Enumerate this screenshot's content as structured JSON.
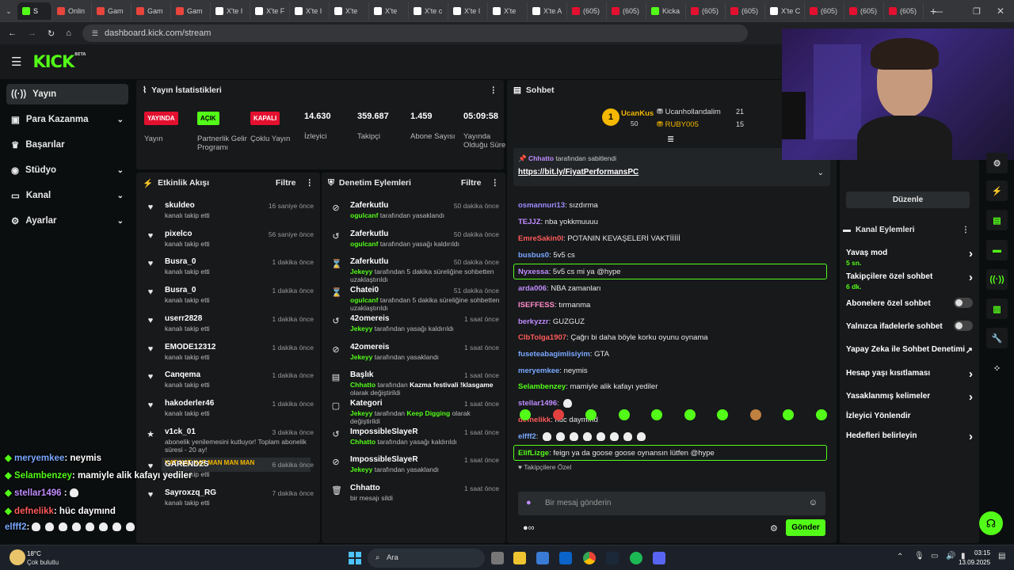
{
  "browser": {
    "tabs": [
      "S",
      "Onlin",
      "Gam",
      "Gam",
      "Gam",
      "X'te I",
      "X'te F",
      "X'te I",
      "X'te",
      "X'te",
      "X'te c",
      "X'te I",
      "X'te",
      "X'te A",
      "(605)",
      "(605)",
      "Kicka",
      "(605)",
      "(605)",
      "X'te C",
      "(605)",
      "(605)",
      "(605)"
    ],
    "url": "dashboard.kick.com/stream"
  },
  "app": {
    "logo": "KICK",
    "beta": "BETA"
  },
  "sidebar": {
    "items": [
      {
        "label": "Yayın",
        "icon": "broadcast-icon"
      },
      {
        "label": "Para Kazanma",
        "icon": "dollar-icon"
      },
      {
        "label": "Başarılar",
        "icon": "trophy-icon"
      },
      {
        "label": "Stüdyo",
        "icon": "studio-icon"
      },
      {
        "label": "Kanal",
        "icon": "channel-icon"
      },
      {
        "label": "Ayarlar",
        "icon": "gear-icon"
      }
    ]
  },
  "stats": {
    "title": "Yayın İstatistikleri",
    "items": [
      {
        "badge": "YAYINDA",
        "label": "Yayın",
        "color": "#e3102f"
      },
      {
        "badge": "AÇIK",
        "label": "Partnerlik Gelir Programı",
        "color": "#53fc18"
      },
      {
        "badge": "KAPALI",
        "label": "Çoklu Yayın",
        "color": "#e3102f"
      },
      {
        "value": "14.630",
        "label": "İzleyici"
      },
      {
        "value": "359.687",
        "label": "Takipçi"
      },
      {
        "value": "1.459",
        "label": "Abone Sayısı"
      },
      {
        "value": "05:09:58",
        "label": "Yayında Olduğu Süre"
      }
    ]
  },
  "activity": {
    "title": "Etkinlik Akışı",
    "filter": "Filtre",
    "rows": [
      {
        "name": "skuldeo",
        "sub": "kanalı takip etti",
        "time": "16 saniye önce"
      },
      {
        "name": "pixelco",
        "sub": "kanalı takip etti",
        "time": "56 saniye önce"
      },
      {
        "name": "Busra_0",
        "sub": "kanalı takip etti",
        "time": "1 dakika önce"
      },
      {
        "name": "Busra_0",
        "sub": "kanalı takip etti",
        "time": "1 dakika önce"
      },
      {
        "name": "userr2828",
        "sub": "kanalı takip etti",
        "time": "1 dakika önce"
      },
      {
        "name": "EMODE12312",
        "sub": "kanalı takip etti",
        "time": "1 dakika önce"
      },
      {
        "name": "Canqema",
        "sub": "kanalı takip etti",
        "time": "1 dakika önce"
      },
      {
        "name": "hakoderler46",
        "sub": "kanalı takip etti",
        "time": "1 dakika önce"
      },
      {
        "name": "v1ck_01",
        "sub": "abonelik yenilemesini kutluyor! Toplam abonelik süresi - 20 ay!",
        "time": "3 dakika önce"
      },
      {
        "name": "GAREND2S",
        "sub": "kanalı takip etti",
        "time": "6 dakika önce"
      },
      {
        "name": "Sayroxzq_RG",
        "sub": "kanalı takip etti",
        "time": "7 dakika önce"
      }
    ],
    "sub_message": "KAT KAT KAT MAN MAN MAN"
  },
  "moderation": {
    "title": "Denetim Eylemleri",
    "filter": "Filtre",
    "rows": [
      {
        "name": "Zaferkutlu",
        "actor": "ogulcanf",
        "rest": "tarafından yasaklandı",
        "time": "50 dakika önce",
        "icon": "ban-icon"
      },
      {
        "name": "Zaferkutlu",
        "actor": "ogulcanf",
        "rest": "tarafından yasağı kaldırıldı",
        "time": "50 dakika önce",
        "icon": "undo-icon"
      },
      {
        "name": "Zaferkutlu",
        "actor": "Jekeyy",
        "rest": "tarafından 5 dakika süreliğine sohbetten uzaklaştırıldı",
        "time": "50 dakika önce",
        "icon": "hourglass-icon"
      },
      {
        "name": "Chatei0",
        "actor": "ogulcanf",
        "rest": "tarafından 5 dakika süreliğine sohbetten uzaklaştırıldı",
        "time": "51 dakika önce",
        "icon": "hourglass-icon"
      },
      {
        "name": "42omereis",
        "actor": "Jekeyy",
        "rest": "tarafından yasağı kaldırıldı",
        "time": "1 saat önce",
        "icon": "undo-icon"
      },
      {
        "name": "42omereis",
        "actor": "Jekeyy",
        "rest": "tarafından yasaklandı",
        "time": "1 saat önce",
        "icon": "ban-icon"
      },
      {
        "name": "Başlık",
        "actor": "Chhatto",
        "rest": "tarafından",
        "extra": "Kazma festivali !klasgame",
        "rest2": "olarak değiştirildi",
        "time": "1 saat önce",
        "icon": "title-icon"
      },
      {
        "name": "Kategori",
        "actor": "Jekeyy",
        "rest": "tarafından",
        "extra": "Keep Digging",
        "extra_green": true,
        "rest2": "olarak değiştirildi",
        "time": "1 saat önce",
        "icon": "category-icon"
      },
      {
        "name": "ImpossibleSlayeR",
        "actor": "Chhatto",
        "rest": "tarafından yasağı kaldırıldı",
        "time": "1 saat önce",
        "icon": "undo-icon"
      },
      {
        "name": "ImpossibleSlayeR",
        "actor": "Jekeyy",
        "rest": "tarafından yasaklandı",
        "time": "1 saat önce",
        "icon": "ban-icon"
      },
      {
        "name": "Chhatto",
        "actor": "",
        "rest": "bir mesajı sildi",
        "time": "1 saat önce",
        "icon": "trash-icon"
      }
    ]
  },
  "chat": {
    "title": "Sohbet",
    "top_gifters": [
      {
        "rank": "1",
        "name": "UcanKus",
        "count": "50"
      },
      {
        "name": "Ucanhollandalim",
        "count": "21"
      },
      {
        "name": "RUBY005",
        "count": "15"
      }
    ],
    "pinned": {
      "by": "Chhatto",
      "label": "tarafından sabitlendi",
      "link": "https://bit.ly/FiyatPerformansPC"
    },
    "messages": [
      {
        "user": "osmannuri13",
        "color": "#9b8cff",
        "text": "sızdırma"
      },
      {
        "user": "TEJJZ",
        "color": "#c08cff",
        "text": "nba yokkmuuuu"
      },
      {
        "user": "EmreSakin0l",
        "color": "#ff5a5a",
        "text": "POTANIN KEVAŞELERİ VAKTİİİİİ"
      },
      {
        "user": "busbus0",
        "color": "#7aa8ff",
        "text": "5v5 cs"
      },
      {
        "user": "Nyxessa",
        "color": "#c08cff",
        "text": "5v5 cs mi ya @hype",
        "highlight": true
      },
      {
        "user": "arda006",
        "color": "#c08cff",
        "text": "NBA zamanları"
      },
      {
        "user": "ISEFFESS",
        "color": "#ff8cc8",
        "text": "tırmanma"
      },
      {
        "user": "berkyzzr",
        "color": "#c08cff",
        "text": "GUZGUZ"
      },
      {
        "user": "ClbTolga1907",
        "color": "#ff5a5a",
        "text": "Çağrı bi daha böyle korku oyunu oynama"
      },
      {
        "user": "fuseteabagimlisiyim",
        "color": "#7aa8ff",
        "text": "GTA"
      },
      {
        "user": "meryemkee",
        "color": "#7aa8ff",
        "text": "neymis"
      },
      {
        "user": "Selambenzey",
        "color": "#53fc18",
        "text": "mamiyle alik kafayı yediler"
      },
      {
        "user": "stellar1496",
        "color": "#c08cff",
        "text": ""
      },
      {
        "user": "defnelikk",
        "color": "#ff5a5a",
        "text": "hüc daymınd"
      },
      {
        "user": "elfff2",
        "color": "#7aa8ff",
        "text": ""
      },
      {
        "user": "ElifLizge",
        "color": "#53fc18",
        "text": "feign ya da goose goose oynansın lütfen @hype",
        "highlight": true
      }
    ],
    "emote_section": "Takipçilere Özel",
    "placeholder": "Bir mesaj gönderin",
    "send": "Gönder"
  },
  "right": {
    "edit": "Düzenle",
    "title": "Kanal Eylemleri",
    "actions": [
      {
        "label": "Yavaş mod",
        "sub": "5 sn.",
        "ctrl": "arrow"
      },
      {
        "label": "Takipçilere özel sohbet",
        "sub": "6 dk.",
        "ctrl": "arrow"
      },
      {
        "label": "Abonelere özel sohbet",
        "ctrl": "toggle"
      },
      {
        "label": "Yalnızca ifadelerle sohbet",
        "ctrl": "toggle"
      },
      {
        "label": "Yapay Zeka ile Sohbet Denetimi",
        "ctrl": "external"
      },
      {
        "label": "Hesap yaşı kısıtlaması",
        "ctrl": "arrow"
      },
      {
        "label": "Yasaklanmış kelimeler",
        "ctrl": "arrow"
      },
      {
        "label": "İzleyici Yönlendir",
        "ctrl": "none"
      },
      {
        "label": "Hedefleri belirleyin",
        "ctrl": "arrow"
      }
    ]
  },
  "overlay": [
    {
      "user": "meryemkee",
      "text": ": neymis",
      "color": "#7aa8ff"
    },
    {
      "user": "Selambenzey",
      "text": ": mamiyle alik kafayı yediler",
      "color": "#53fc18"
    },
    {
      "user": "stellar1496",
      "text": " :",
      "color": "#c08cff"
    },
    {
      "user": "defnelikk",
      "text": ": hüc daymınd",
      "color": "#ff5a5a"
    },
    {
      "user": "elfff2",
      "text": ":",
      "color": "#7aa8ff"
    }
  ],
  "taskbar": {
    "weather_temp": "18°C",
    "weather_text": "Çok bulutlu",
    "search": "Ara",
    "time": "03:15",
    "date": "13.09.2025"
  }
}
